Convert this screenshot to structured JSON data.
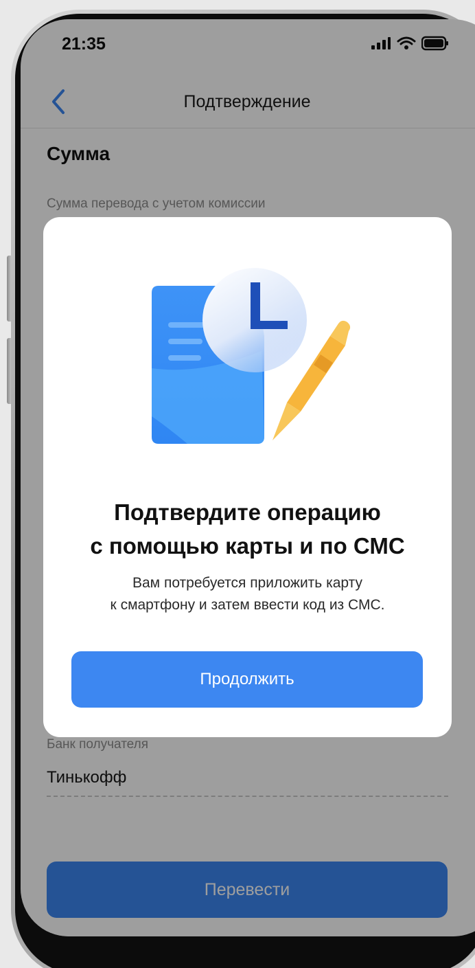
{
  "status_bar": {
    "time": "21:35"
  },
  "nav": {
    "title": "Подтверждение"
  },
  "page": {
    "section_title": "Сумма",
    "sum_label": "Сумма перевода с учетом комиссии",
    "bank_label": "Банк получателя",
    "bank_value": "Тинькофф",
    "transfer_button": "Перевести"
  },
  "modal": {
    "title_lines": [
      "Подтвердите операцию",
      "с помощью карты и по СМС"
    ],
    "text_lines": [
      "Вам потребуется приложить карту",
      "к смартфону и затем ввести код из СМС."
    ],
    "continue_button": "Продолжить",
    "illustration_icons": [
      "document-icon",
      "clock-icon",
      "pen-icon"
    ]
  },
  "colors": {
    "accent": "#3d87f1",
    "document": "#3a8ef6",
    "clock_hand": "#1e4fb8",
    "pen": "#f7b53b"
  }
}
